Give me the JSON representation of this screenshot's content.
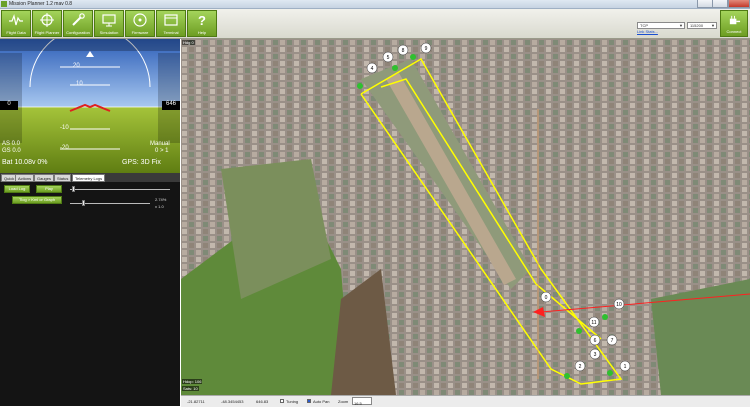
{
  "window": {
    "title": "Mission Planner 1.2 mav 0.8"
  },
  "toolbar": {
    "buttons": [
      {
        "label": "Flight Data"
      },
      {
        "label": "Flight Planner"
      },
      {
        "label": "Configuration"
      },
      {
        "label": "Simulation"
      },
      {
        "label": "Firmware"
      },
      {
        "label": "Terminal"
      },
      {
        "label": "Help"
      }
    ],
    "port": "TCP",
    "baud": "115200",
    "link_stats": "Link Stats...",
    "connect": "Connect"
  },
  "hud": {
    "altitude_left": "0",
    "altitude_right": "646",
    "as": "AS 0.0",
    "gs": "GS 0.0",
    "mode": "Manual",
    "armed": "0 > 1",
    "battery": "Bat 10.08v 0%",
    "gps": "GPS: 3D Fix",
    "pitch_labels": [
      "20",
      "10",
      "-10",
      "-20"
    ]
  },
  "tabs": [
    {
      "label": "Quick"
    },
    {
      "label": "Actions"
    },
    {
      "label": "Gauges"
    },
    {
      "label": "Status"
    },
    {
      "label": "Telemetry Logs"
    }
  ],
  "telemetry": {
    "load_log": "Load Log",
    "play": "Play",
    "tlog_graph": "Tlog > Kml or Graph",
    "percent": "2.74%",
    "speed": "x 1.0"
  },
  "map": {
    "hdg": "Hdg 0",
    "overlay_lines": [
      "Hdop: 106",
      "Sats: 10"
    ],
    "waypoints": [
      {
        "label": "0"
      },
      {
        "label": "1"
      },
      {
        "label": "2"
      },
      {
        "label": "3"
      },
      {
        "label": "4"
      },
      {
        "label": "5"
      },
      {
        "label": "6"
      },
      {
        "label": "7"
      },
      {
        "label": "8"
      },
      {
        "label": "9"
      },
      {
        "label": "10"
      },
      {
        "label": "11"
      }
    ]
  },
  "statusbar": {
    "lat": "-21.82711",
    "lng": "-48.3454453",
    "alt": "646.83",
    "tuning": "Tuning",
    "autopan": "Auto Pan",
    "zoom_label": "Zoom",
    "zoom_value": "16.5"
  },
  "colors": {
    "accent_green": "#7fb32f",
    "route_yellow": "#ffff00",
    "link_blue": "#1a4fd0"
  }
}
